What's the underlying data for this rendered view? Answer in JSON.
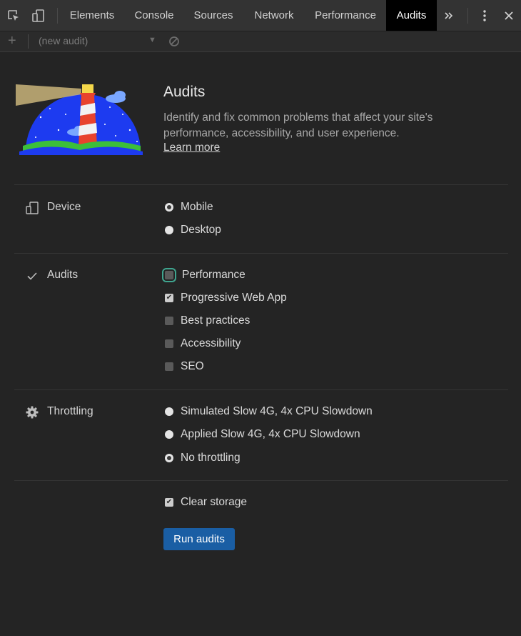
{
  "tabs": [
    {
      "label": "Elements",
      "active": false
    },
    {
      "label": "Console",
      "active": false
    },
    {
      "label": "Sources",
      "active": false
    },
    {
      "label": "Network",
      "active": false
    },
    {
      "label": "Performance",
      "active": false
    },
    {
      "label": "Audits",
      "active": true
    }
  ],
  "toolbar_icons": {
    "inspect": "inspect-element-icon",
    "device": "device-toolbar-icon",
    "overflow": "more-tabs-icon",
    "menu": "kebab-menu-icon",
    "close": "close-icon"
  },
  "toolbar": {
    "add_symbol": "+",
    "audit_select_value": "(new audit)",
    "clear_icon": "block-icon"
  },
  "header": {
    "title": "Audits",
    "description": "Identify and fix common problems that affect your site's performance, accessibility, and user experience.",
    "learn_more": "Learn more"
  },
  "device": {
    "label": "Device",
    "options": [
      {
        "label": "Mobile",
        "checked": true
      },
      {
        "label": "Desktop",
        "checked": false
      }
    ]
  },
  "audits": {
    "label": "Audits",
    "options": [
      {
        "label": "Performance",
        "checked": false,
        "focused": true
      },
      {
        "label": "Progressive Web App",
        "checked": true
      },
      {
        "label": "Best practices",
        "checked": false
      },
      {
        "label": "Accessibility",
        "checked": false
      },
      {
        "label": "SEO",
        "checked": false
      }
    ]
  },
  "throttling": {
    "label": "Throttling",
    "options": [
      {
        "label": "Simulated Slow 4G, 4x CPU Slowdown",
        "checked": false
      },
      {
        "label": "Applied Slow 4G, 4x CPU Slowdown",
        "checked": false
      },
      {
        "label": "No throttling",
        "checked": true
      }
    ]
  },
  "clear_storage": {
    "label": "Clear storage",
    "checked": true
  },
  "run_button": {
    "label": "Run audits"
  },
  "colors": {
    "background": "#242424",
    "tabbar": "#333333",
    "active_tab": "#000000",
    "button": "#1a5ea4",
    "focus_ring": "#3fa58f"
  }
}
